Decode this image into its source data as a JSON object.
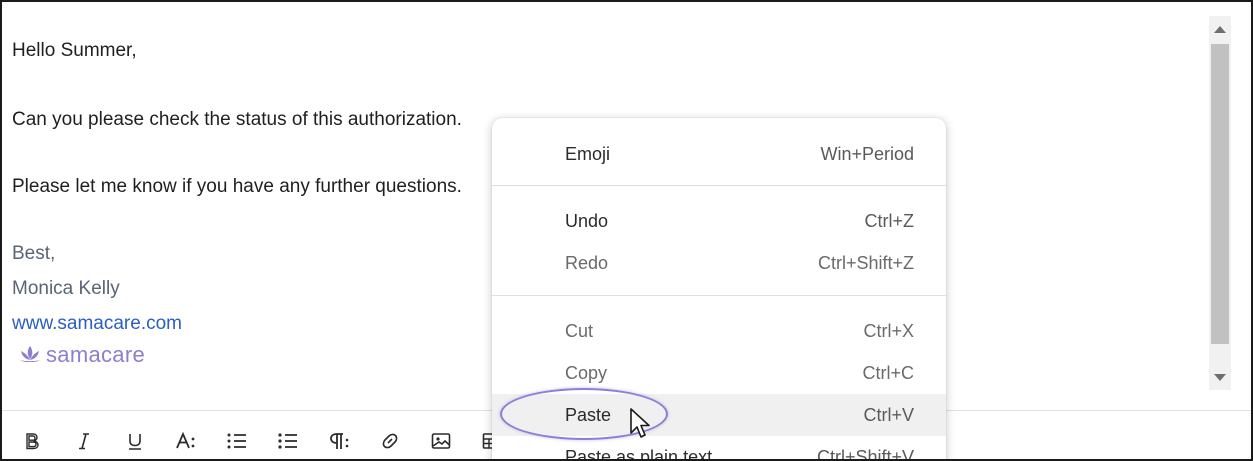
{
  "email": {
    "greeting": "Hello Summer,",
    "line1": "Can you please check the status of this authorization.",
    "line2": "Please let me know if you have any further questions.",
    "signoff": "Best,",
    "sender_name": "Monica Kelly",
    "website": "www.samacare.com",
    "logo_text": "samacare"
  },
  "context_menu": {
    "items": [
      {
        "label": "Emoji",
        "shortcut": "Win+Period"
      },
      {
        "label": "Undo",
        "shortcut": "Ctrl+Z"
      },
      {
        "label": "Redo",
        "shortcut": "Ctrl+Shift+Z"
      },
      {
        "label": "Cut",
        "shortcut": "Ctrl+X"
      },
      {
        "label": "Copy",
        "shortcut": "Ctrl+C"
      },
      {
        "label": "Paste",
        "shortcut": "Ctrl+V"
      },
      {
        "label": "Paste as plain text",
        "shortcut": "Ctrl+Shift+V"
      }
    ],
    "highlighted_item": "Paste"
  },
  "toolbar": {
    "icons": [
      "bold-icon",
      "italic-icon",
      "underline-icon",
      "font-size-icon",
      "numbered-list-icon",
      "bulleted-list-icon",
      "paragraph-icon",
      "link-icon",
      "image-icon",
      "table-icon"
    ]
  },
  "colors": {
    "link": "#2a5fc4",
    "signature": "#5a6474",
    "logo": "#8a7fd0",
    "highlight_ring": "#8a7fd6",
    "menu_hover": "#f0f0f0"
  }
}
